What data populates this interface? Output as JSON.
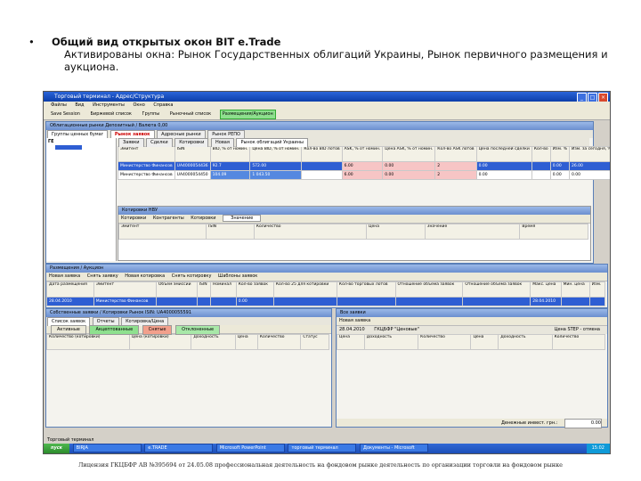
{
  "slide": {
    "bullet": "•",
    "title": "Общий вид открытых окон BIT e.Trade",
    "subtitle": "Активированы окна: Рынок Государственных облигаций Украины, Рынок первичного размещения и аукциона.",
    "footer": "Лицензия ГКЦБФР АВ №395694 от 24.05.08 профессиональная деятельность на фондовом рынке деятельность по организации торговли на фондовом рынке"
  },
  "app": {
    "title": "Торговый терминал - Адрес/Структура",
    "menu": [
      "Файлы",
      "Вид",
      "Инструменты",
      "Окно",
      "Справка"
    ],
    "toolbar": [
      "Save Session",
      "Биржевой список",
      "Группы",
      "Рыночный список",
      "Размещения/Аукцион"
    ]
  },
  "win_bonds": {
    "title": "Облигационные рынки  Депозитный / Валюта  0,00",
    "tabs": [
      "Группы ценных бумаг",
      "Рынок заявок",
      "Адресные рынки",
      "Рынок РЕПО"
    ],
    "subtabs": [
      "Заявки",
      "Сделки",
      "Котировки",
      "Новая",
      "Рынок облигаций Украины"
    ],
    "tree_root": "ГЕ",
    "columns": [
      "Эмитент",
      "ISIN",
      "BID, % от номин.",
      "Цена BID, % от номин.",
      "Кол-во BID лотов",
      "ASK, % от номин.",
      "Цена ASK, % от номин.",
      "Кол-во ASK лотов",
      "Цена последней сделки",
      "Кол-во",
      "Изм. %",
      "Изм. за сегодня, %"
    ],
    "rows": [
      {
        "issuer": "Министерство Финансов",
        "isin": "UA4000054436",
        "bid": "92.7",
        "bid_price": "572.00",
        "bid_qty": "",
        "ask": "6.00",
        "ask_price": "0.00",
        "ask_qty": "2",
        "last": "0.00",
        "qty": "",
        "chg": "0.00",
        "chg2": "26.00"
      },
      {
        "issuer": "Министерство Финансов",
        "isin": "UA4000054450",
        "bid": "104.09",
        "bid_price": "1 043.50",
        "bid_qty": "",
        "ask": "6.00",
        "ask_price": "0.00",
        "ask_qty": "2",
        "last": "0.00",
        "qty": "",
        "chg": "0.00",
        "chg2": "0.00"
      }
    ],
    "market_title": "Котировки НВУ",
    "market_controls": [
      "Котировки",
      "Контрагенты",
      "Котировки",
      "Значение"
    ],
    "market_columns": [
      "Эмитент",
      "ISIN",
      "Количество",
      "Цена",
      "Значение",
      "Время"
    ]
  },
  "win_placement": {
    "title": "Размещения / Аукцион",
    "toolbar": [
      "Новая заявка",
      "Снять заявку",
      "Новая котировка",
      "Снять котировку",
      "Шаблоны заявок"
    ],
    "columns": [
      "Дата размещения",
      "Эмитент",
      "Объем эмиссии",
      "ISIN",
      "Номинал",
      "Кол-во заявок",
      "Кол-во 25 для котировки",
      "Кол-во торговых лотов",
      "Отношение объема заявок",
      "Отношение объема заявок",
      "Макс. цена",
      "Мин. цена",
      "Изм."
    ],
    "row": {
      "date": "28.04.2010",
      "issuer": "Министерство Финансов",
      "volume": "",
      "isin": "",
      "nominal": "",
      "n1": "0.00",
      "n2": "",
      "n3": "",
      "ratio1": "",
      "ratio2": "",
      "date2": "28.04.2010",
      "max": "",
      "min": ""
    }
  },
  "win_orders": {
    "title": "Собственные заявки / Котировки  Рынок  ISIN: UA4000055591",
    "tabs": [
      "Список заявок",
      "Отчеты",
      "Котировка/Цена"
    ],
    "filters": [
      "Активные",
      "Акцептованные",
      "Снятые",
      "Отклоненные"
    ],
    "columns": [
      "Количество (котировки)",
      "Цена (котировки)",
      "Доходность",
      "Цена",
      "Количество",
      "Статус"
    ]
  },
  "win_quotes": {
    "title": "Все заявки",
    "toolbar": [
      "Новая заявка"
    ],
    "row": {
      "date": "28.04.2010",
      "place": "ГКЦБФР \"Ценовые\"",
      "info": "Цена STEP - отмена"
    },
    "columns": [
      "Цена",
      "Доходность",
      "Количество",
      "Цена",
      "Доходность",
      "Количество"
    ],
    "cash_label": "Денежные инвест. грн.:",
    "cash_value": "0.00"
  },
  "statusbar": "Торговый терминал",
  "taskbar": {
    "start": "пуск",
    "tasks": [
      "BIRJA",
      "e.TRADE",
      "Microsoft PowerPoint",
      "торговый терминал",
      "Документы - Microsoft"
    ],
    "clock": "15:02"
  }
}
